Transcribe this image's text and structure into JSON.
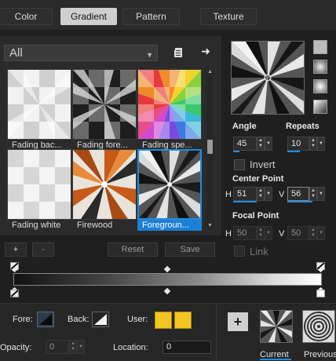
{
  "tabs": [
    "Color",
    "Gradient",
    "Pattern",
    "Texture"
  ],
  "active_tab": "Gradient",
  "library": {
    "dropdown_value": "All",
    "items": [
      {
        "label": "Fading bac..."
      },
      {
        "label": "Fading fore..."
      },
      {
        "label": "Fading spe..."
      },
      {
        "label": "Fading white"
      },
      {
        "label": "Firewood"
      },
      {
        "label": "Foregroun..."
      }
    ],
    "selected_index": 5
  },
  "settings": {
    "angle_label": "Angle",
    "angle_value": "45",
    "repeats_label": "Repeats",
    "repeats_value": "10",
    "invert_label": "Invert",
    "center_point_label": "Center Point",
    "center_h_label": "H",
    "center_h_value": "51",
    "center_v_label": "V",
    "center_v_value": "56",
    "focal_point_label": "Focal Point",
    "focal_h_label": "H",
    "focal_h_value": "50",
    "focal_v_label": "V",
    "focal_v_value": "50",
    "link_label": "Link"
  },
  "editor": {
    "add_label": "+",
    "remove_label": "-",
    "reset_label": "Reset",
    "save_label": "Save"
  },
  "footer": {
    "fore_label": "Fore:",
    "back_label": "Back:",
    "user_label": "User:",
    "opacity_label": "Opacity:",
    "opacity_value": "0",
    "location_label": "Location:",
    "location_value": "0",
    "add_label": "+",
    "current_label": "Current",
    "previous_label": "Previous",
    "user_colors": [
      "#f2c524",
      "#f2c524"
    ]
  },
  "icons": [
    "new-gradient-icon",
    "arrow-right-icon",
    "style-linear-icon",
    "style-rectangular-icon",
    "style-sunburst-icon",
    "style-radial-icon"
  ]
}
